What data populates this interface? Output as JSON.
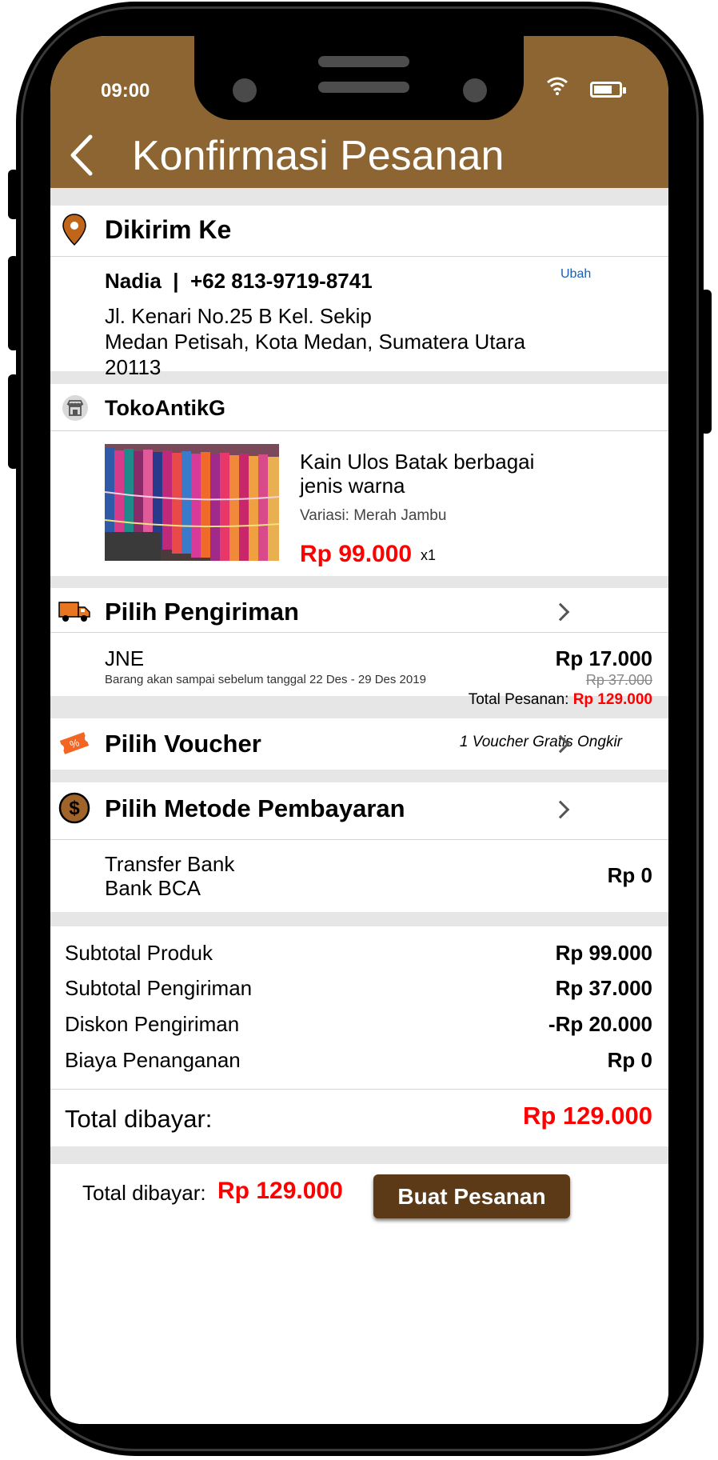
{
  "status_bar": {
    "time": "09:00"
  },
  "header": {
    "title": "Konfirmasi Pesanan"
  },
  "shipping_address": {
    "heading": "Dikirim Ke",
    "contact": "Nadia  |  +62 813-9719-8741",
    "edit_label": "Ubah",
    "address_line1": "Jl. Kenari No.25 B Kel. Sekip",
    "address_line2": "Medan Petisah, Kota Medan, Sumatera Utara",
    "address_line3": "20113"
  },
  "store": {
    "name": "TokoAntikG",
    "product": {
      "name_line1": "Kain Ulos Batak berbagai",
      "name_line2": "jenis warna",
      "variation": "Variasi: Merah Jambu",
      "price": "Rp 99.000",
      "qty": "x1"
    }
  },
  "shipping": {
    "heading": "Pilih Pengiriman",
    "courier": "JNE",
    "eta": "Barang akan sampai sebelum tanggal 22 Des - 29 Des 2019",
    "price": "Rp 17.000",
    "original_price": "Rp 37.000"
  },
  "order_total": {
    "label": "Total Pesanan: ",
    "value": "Rp 129.000"
  },
  "voucher": {
    "heading": "Pilih Voucher",
    "applied": "1 Voucher Gratis Ongkir"
  },
  "payment": {
    "heading": "Pilih Metode Pembayaran",
    "method_line1": "Transfer Bank",
    "method_line2": "Bank BCA",
    "fee": "Rp 0"
  },
  "summary": {
    "rows": [
      {
        "label": "Subtotal Produk",
        "value": "Rp 99.000"
      },
      {
        "label": "Subtotal Pengiriman",
        "value": "Rp 37.000"
      },
      {
        "label": "Diskon Pengiriman",
        "value": "-Rp 20.000"
      },
      {
        "label": "Biaya Penanganan",
        "value": "Rp 0"
      }
    ],
    "total_label": "Total dibayar:",
    "total_value": "Rp 129.000"
  },
  "footer": {
    "total_label": "Total dibayar:",
    "total_value": "Rp 129.000",
    "submit_label": "Buat Pesanan"
  },
  "colors": {
    "header_bg": "#8c6532",
    "accent_red": "#ff0000",
    "button_bg": "#5c3a17",
    "link_blue": "#1a5fb4",
    "icon_orange": "#f26522"
  },
  "icons": [
    "back-icon",
    "location-pin-icon",
    "store-icon",
    "truck-icon",
    "voucher-icon",
    "dollar-coin-icon",
    "chevron-right-icon",
    "wifi-icon",
    "battery-icon"
  ]
}
